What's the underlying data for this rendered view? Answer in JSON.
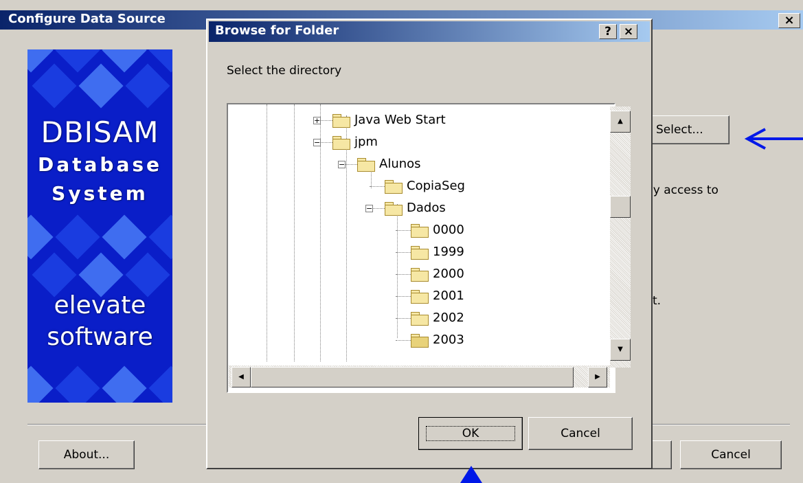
{
  "config_window": {
    "title": "Configure Data Source",
    "close_glyph": "×",
    "banner_lines": [
      "DBISAM",
      "Database",
      "System",
      "elevate",
      "software"
    ],
    "select_button": "Select...",
    "partial_text_1": "ly access to",
    "partial_text_2": "t.",
    "about_button": "About...",
    "cancel_button": "Cancel"
  },
  "browse_dialog": {
    "title": "Browse for Folder",
    "help_glyph": "?",
    "close_glyph": "×",
    "prompt": "Select the directory",
    "tree": [
      {
        "label": "Java Web Start",
        "expander": "+"
      },
      {
        "label": "jpm",
        "expander": "−"
      },
      {
        "label": "Alunos",
        "expander": "−"
      },
      {
        "label": "CopiaSeg",
        "expander": ""
      },
      {
        "label": "Dados",
        "expander": "−"
      },
      {
        "label": "0000",
        "expander": ""
      },
      {
        "label": "1999",
        "expander": ""
      },
      {
        "label": "2000",
        "expander": ""
      },
      {
        "label": "2001",
        "expander": ""
      },
      {
        "label": "2002",
        "expander": ""
      },
      {
        "label": "2003",
        "expander": "",
        "open": true
      }
    ],
    "ok_button": "OK",
    "cancel_button": "Cancel"
  },
  "annotation_color": "#0018e8"
}
